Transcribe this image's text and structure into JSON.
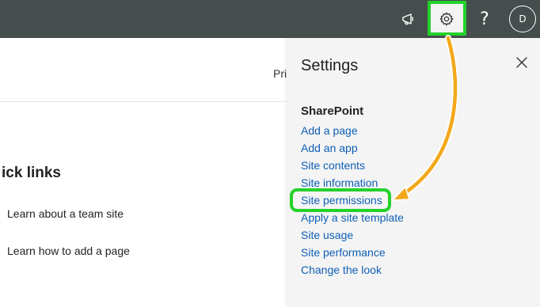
{
  "topbar": {
    "icons": [
      "megaphone-icon",
      "gear-icon",
      "help-icon"
    ],
    "help_label": "?",
    "avatar_initial": "D"
  },
  "left": {
    "partial_text": "Priv",
    "quick_links_title": "ick links",
    "links": [
      "Learn about a team site",
      "Learn how to add a page"
    ]
  },
  "settings": {
    "title": "Settings",
    "section": "SharePoint",
    "items": [
      "Add a page",
      "Add an app",
      "Site contents",
      "Site information",
      "Site permissions",
      "Apply a site template",
      "Site usage",
      "Site performance",
      "Change the look"
    ],
    "highlighted_item": "Site permissions"
  },
  "colors": {
    "topbar": "#464d4d",
    "highlight": "#24d12b",
    "arrow": "#f3a81a",
    "link": "#0f5fb5",
    "panel_bg": "#f4f4f4"
  }
}
